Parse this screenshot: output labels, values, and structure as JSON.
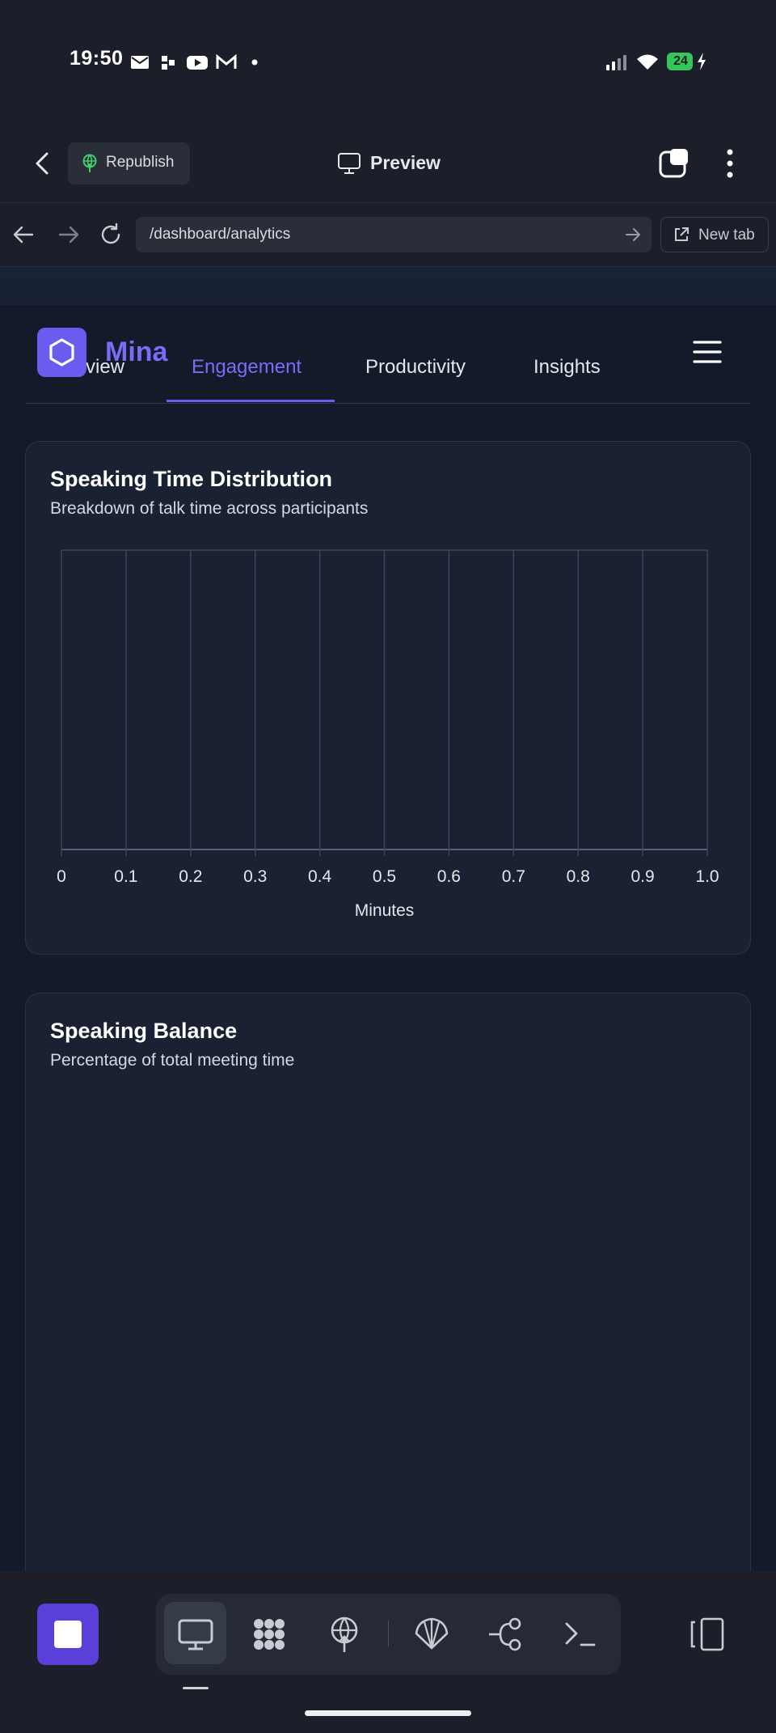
{
  "status_bar": {
    "time": "19:50",
    "battery": "24",
    "icons": [
      "mail-icon",
      "app-icon",
      "youtube-icon",
      "gmail-icon",
      "dot-icon",
      "signal-icon",
      "wifi-icon",
      "battery-icon"
    ]
  },
  "app_header": {
    "republish_label": "Republish",
    "title": "Preview"
  },
  "browser": {
    "url": "/dashboard/analytics",
    "new_tab_label": "New tab"
  },
  "site": {
    "brand": "Mina",
    "tabs": [
      {
        "label": "rview"
      },
      {
        "label": "Engagement",
        "active": true
      },
      {
        "label": "Productivity"
      },
      {
        "label": "Insights"
      }
    ]
  },
  "cards": {
    "distribution": {
      "title": "Speaking Time Distribution",
      "subtitle": "Breakdown of talk time across participants"
    },
    "balance": {
      "title": "Speaking Balance",
      "subtitle": "Percentage of total meeting time"
    }
  },
  "chart_data": {
    "type": "bar",
    "orientation": "horizontal",
    "title": "Speaking Time Distribution",
    "subtitle": "Breakdown of talk time across participants",
    "xlabel": "Minutes",
    "ylabel": "",
    "xlim": [
      0,
      1.0
    ],
    "x_ticks": [
      "0",
      "0.1",
      "0.2",
      "0.3",
      "0.4",
      "0.5",
      "0.6",
      "0.7",
      "0.8",
      "0.9",
      "1.0"
    ],
    "categories": [],
    "values": [],
    "grid": true
  },
  "colors": {
    "accent": "#6b5cf0",
    "page_bg": "#131a2a",
    "card_bg": "#1a2133",
    "grid": "#3d4658"
  }
}
